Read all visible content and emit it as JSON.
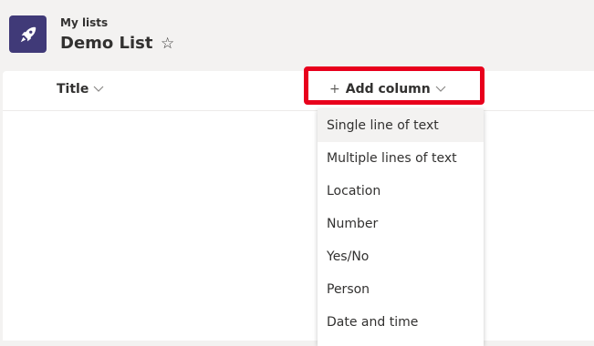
{
  "header": {
    "breadcrumb": "My lists",
    "title": "Demo List",
    "star_glyph": "☆",
    "app_icon": "rocket-icon",
    "app_icon_color": "#403a78"
  },
  "columns": {
    "title_label": "Title",
    "add_column_plus": "+",
    "add_column_label": "Add column"
  },
  "annotation": {
    "highlight_color": "#e8001c"
  },
  "menu": {
    "items": [
      "Single line of text",
      "Multiple lines of text",
      "Location",
      "Number",
      "Yes/No",
      "Person",
      "Date and time"
    ],
    "selected_index": 0
  }
}
